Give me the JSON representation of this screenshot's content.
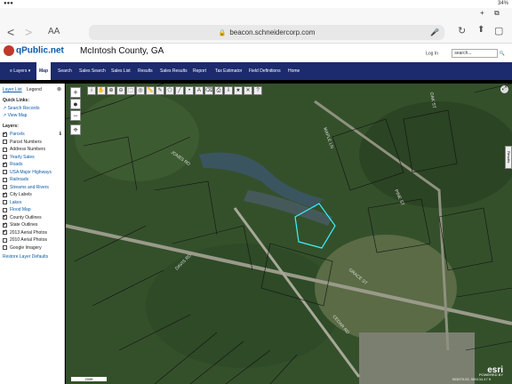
{
  "status": {
    "time": "",
    "battery": "34%"
  },
  "browser": {
    "url": "beacon.schneidercorp.com",
    "back": "<",
    "forward": ">",
    "font_size": "AA",
    "share": "⬆",
    "add_tab": "+",
    "tabs": "⧉"
  },
  "site": {
    "logo": "qPublic.net",
    "county": "McIntosh County, GA",
    "login": "Log In",
    "search_placeholder": "search..."
  },
  "nav": {
    "layers": "≡ Layers ▾",
    "items": [
      "Map",
      "Search",
      "Sales Search",
      "Sales List",
      "Results",
      "Sales Results",
      "Report",
      "Tax Estimator",
      "Field Definitions",
      "Home"
    ]
  },
  "sidebar": {
    "tabs": [
      "Layer List",
      "Legend"
    ],
    "quick_links_title": "Quick Links:",
    "quick_links": [
      "Search Records",
      "View Map"
    ],
    "layers_title": "Layers:",
    "layers": [
      {
        "label": "Parcels",
        "checked": true,
        "link": true
      },
      {
        "label": "Parcel Numbers",
        "checked": false,
        "link": false
      },
      {
        "label": "Address Numbers",
        "checked": false,
        "link": false
      },
      {
        "label": "Yearly Sales",
        "checked": false,
        "link": true
      },
      {
        "label": "Roads",
        "checked": true,
        "link": true
      },
      {
        "label": "USA Major Highways",
        "checked": false,
        "link": true
      },
      {
        "label": "Railroads",
        "checked": false,
        "link": true
      },
      {
        "label": "Streams and Rivers",
        "checked": false,
        "link": true
      },
      {
        "label": "City Labels",
        "checked": true,
        "link": false
      },
      {
        "label": "Lakes",
        "checked": false,
        "link": true
      },
      {
        "label": "Flood Map",
        "checked": false,
        "link": true
      },
      {
        "label": "County Outlines",
        "checked": true,
        "link": false
      },
      {
        "label": "State Outlines",
        "checked": true,
        "link": false
      },
      {
        "label": "2013 Aerial Photos",
        "checked": true,
        "link": false
      },
      {
        "label": "2010 Aerial Photos",
        "checked": false,
        "link": false
      },
      {
        "label": "Google Imagery",
        "checked": false,
        "link": false
      }
    ],
    "restore": "Restore Layer Defaults"
  },
  "map": {
    "results_tab": "Results",
    "scale": "200ft",
    "coords": "903079.03, 555134.47 ft",
    "esri": "esri",
    "esri_sub": "POWERED BY",
    "road_labels": [
      "JONES RD",
      "MAPLE LN",
      "PINE ST",
      "OAK ST",
      "DAVIS RD",
      "GRACE ST",
      "CEDAR RD"
    ]
  }
}
